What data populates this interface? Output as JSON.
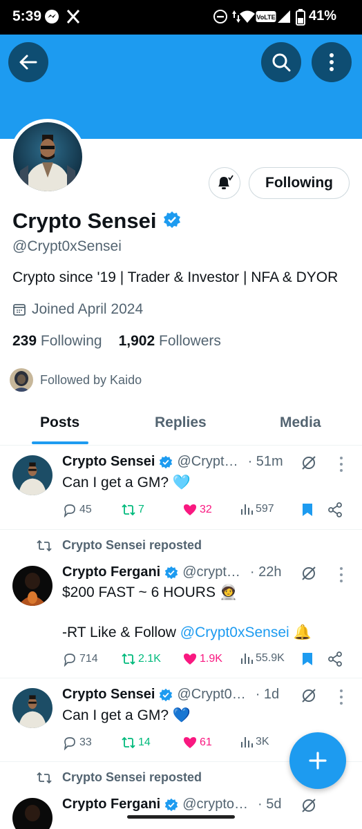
{
  "status_bar": {
    "time": "5:39",
    "battery": "41%"
  },
  "profile": {
    "display_name": "Crypto Sensei",
    "handle": "@Crypt0xSensei",
    "bio": "Crypto since '19 | Trader & Investor | NFA & DYOR",
    "joined": "Joined April 2024",
    "following_count": "239",
    "following_label": "Following",
    "followers_count": "1,902",
    "followers_label": "Followers",
    "followed_by": "Followed by Kaido",
    "follow_button": "Following"
  },
  "tabs": [
    "Posts",
    "Replies",
    "Media"
  ],
  "posts": [
    {
      "name": "Crypto Sensei",
      "handle": "@Crypt…",
      "time": "· 51m",
      "lines": [
        "Can I get a GM? 🩵"
      ],
      "replies": "45",
      "reposts": "7",
      "likes": "32",
      "views": "597"
    },
    {
      "repost_label": "Crypto Sensei reposted",
      "name": "Crypto Fergani",
      "handle": "@crypt…",
      "time": "· 22h",
      "lines": [
        "$200 FAST ~ 6 HOURS 🧑‍🚀"
      ],
      "line2_prefix": "-RT Like & Follow ",
      "line2_link": "@Crypt0xSensei",
      "line2_suffix": " 🔔",
      "replies": "714",
      "reposts": "2.1K",
      "likes": "1.9K",
      "views": "55.9K"
    },
    {
      "name": "Crypto Sensei",
      "handle": "@Crypt0…",
      "time": "· 1d",
      "lines": [
        "Can I get a GM? 💙"
      ],
      "replies": "33",
      "reposts": "14",
      "likes": "61",
      "views": "3K"
    },
    {
      "repost_label": "Crypto Sensei reposted",
      "name": "Crypto Fergani",
      "handle": "@crypto…",
      "time": "· 5d"
    }
  ],
  "colors": {
    "accent": "#1d9bf0",
    "repost_green": "#00ba7c",
    "like_pink": "#f91880",
    "text_secondary": "#536471"
  }
}
